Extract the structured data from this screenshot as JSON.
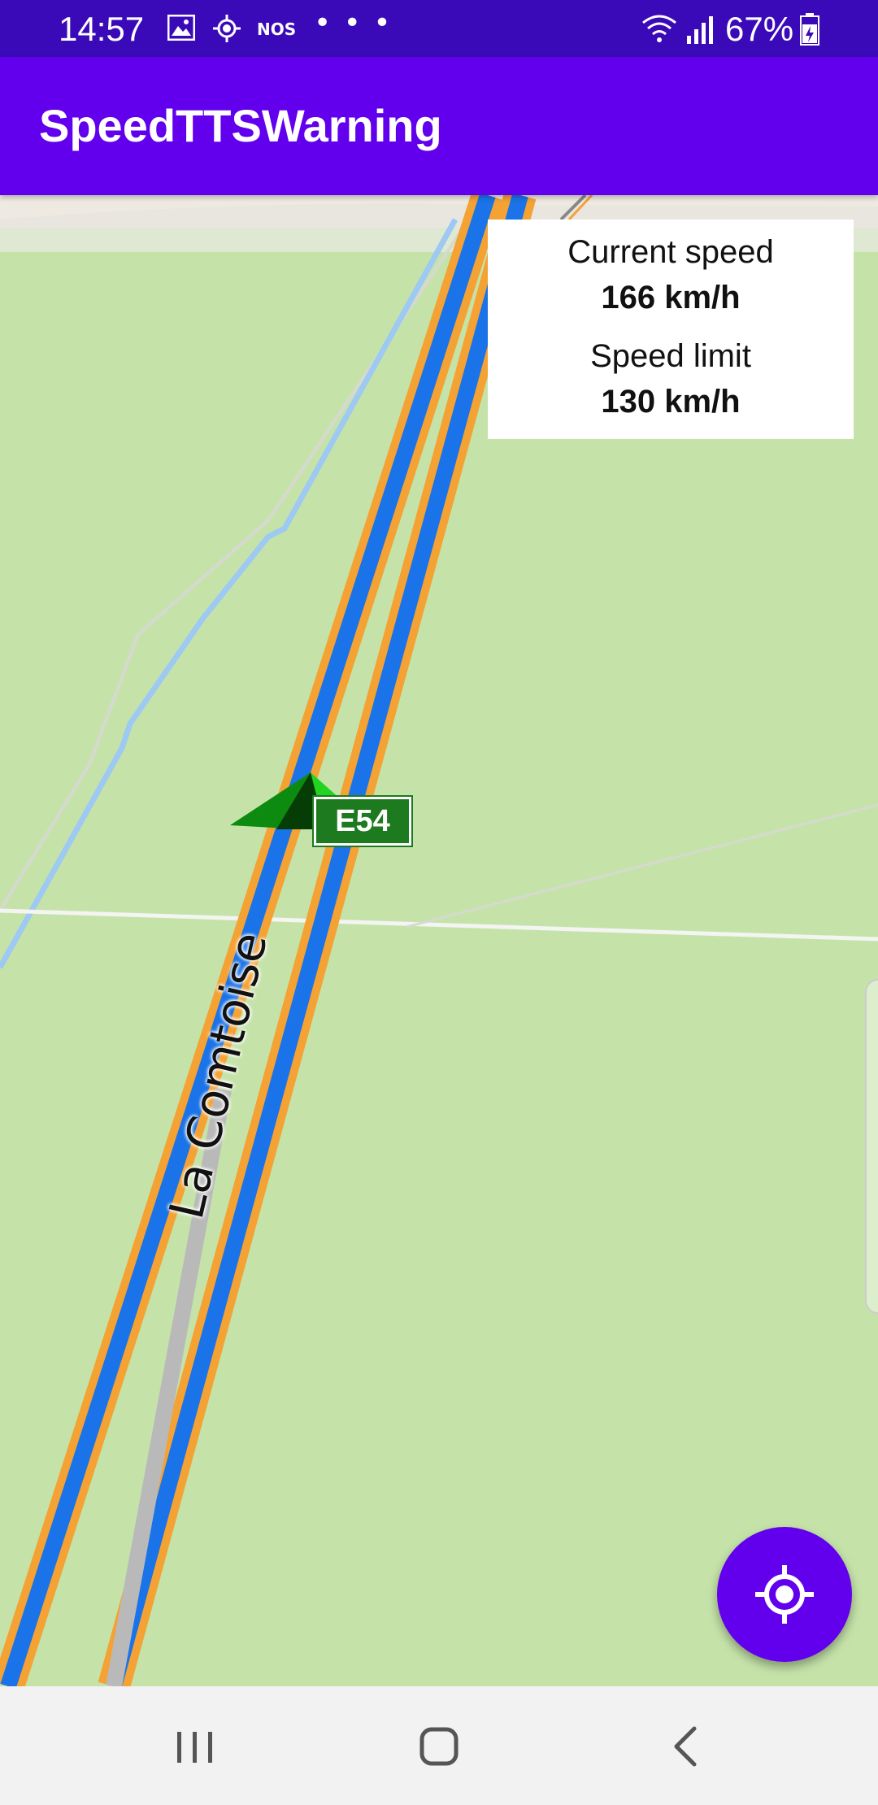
{
  "status_bar": {
    "time": "14:57",
    "network": "NOS",
    "more": "• • •",
    "battery": "67%",
    "icons": [
      "image-icon",
      "location-icon",
      "wifi-icon",
      "signal-icon",
      "battery-icon"
    ]
  },
  "app_bar": {
    "title": "SpeedTTSWarning"
  },
  "speed_panel": {
    "current_label": "Current speed",
    "current_value": "166 km/h",
    "limit_label": "Speed limit",
    "limit_value": "130 km/h"
  },
  "map": {
    "road_name": "La Comtoise",
    "route_shield": "E54",
    "colors": {
      "land": "#c5e3a9",
      "motorway_casing": "#f5a234",
      "motorway_fill": "#1a73e8",
      "river": "#9ec9f2"
    }
  },
  "fab": {
    "icon": "my-location-icon"
  },
  "nav_bar": {
    "icons": [
      "recents-icon",
      "home-icon",
      "back-icon"
    ]
  }
}
